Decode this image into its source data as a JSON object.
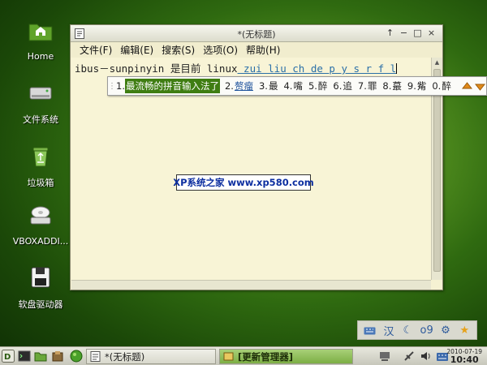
{
  "desktop": {
    "icons": [
      {
        "label": "Home",
        "icon": "home-folder-icon"
      },
      {
        "label": "文件系统",
        "icon": "hard-drive-icon"
      },
      {
        "label": "垃圾箱",
        "icon": "trash-icon"
      },
      {
        "label": "VBOXADDI...",
        "icon": "cd-drive-icon"
      },
      {
        "label": "软盘驱动器",
        "icon": "floppy-icon"
      }
    ]
  },
  "window": {
    "title": "*(无标题)",
    "controls": [
      "↑",
      "−",
      "□",
      "×"
    ],
    "menu": [
      "文件(F)",
      "编辑(E)",
      "搜索(S)",
      "选项(O)",
      "帮助(H)"
    ],
    "editor": {
      "committed_text": "ibus－sunpinyin 是目前 linux",
      "preedit_text": " zui liu ch de p y s r f l"
    }
  },
  "ime": {
    "candidates": [
      {
        "num": "1.",
        "word": "最流畅的拼音输入法了",
        "selected": true
      },
      {
        "num": "2.",
        "word": "赘瘤",
        "underlined": true
      },
      {
        "num": "3.",
        "word": "最"
      },
      {
        "num": "4.",
        "word": "嘴"
      },
      {
        "num": "5.",
        "word": "醉"
      },
      {
        "num": "6.",
        "word": "追"
      },
      {
        "num": "7.",
        "word": "罪"
      },
      {
        "num": "8.",
        "word": "蕞"
      },
      {
        "num": "9.",
        "word": "觜"
      },
      {
        "num": "0.",
        "word": "醉"
      }
    ],
    "toolbar": {
      "mode_label": "汉"
    }
  },
  "watermark": "XP系统之家 www.xp580.com",
  "taskbar": {
    "tasks": [
      {
        "label": "*(无标题)",
        "active": false
      },
      {
        "label": "[更新管理器]",
        "active": true
      }
    ],
    "date": "2010-07-19",
    "time": "10:40"
  },
  "colors": {
    "selection": "#3f7d12",
    "taskbar_active": "#8fbf55",
    "window_bg": "#f5f1d2"
  }
}
